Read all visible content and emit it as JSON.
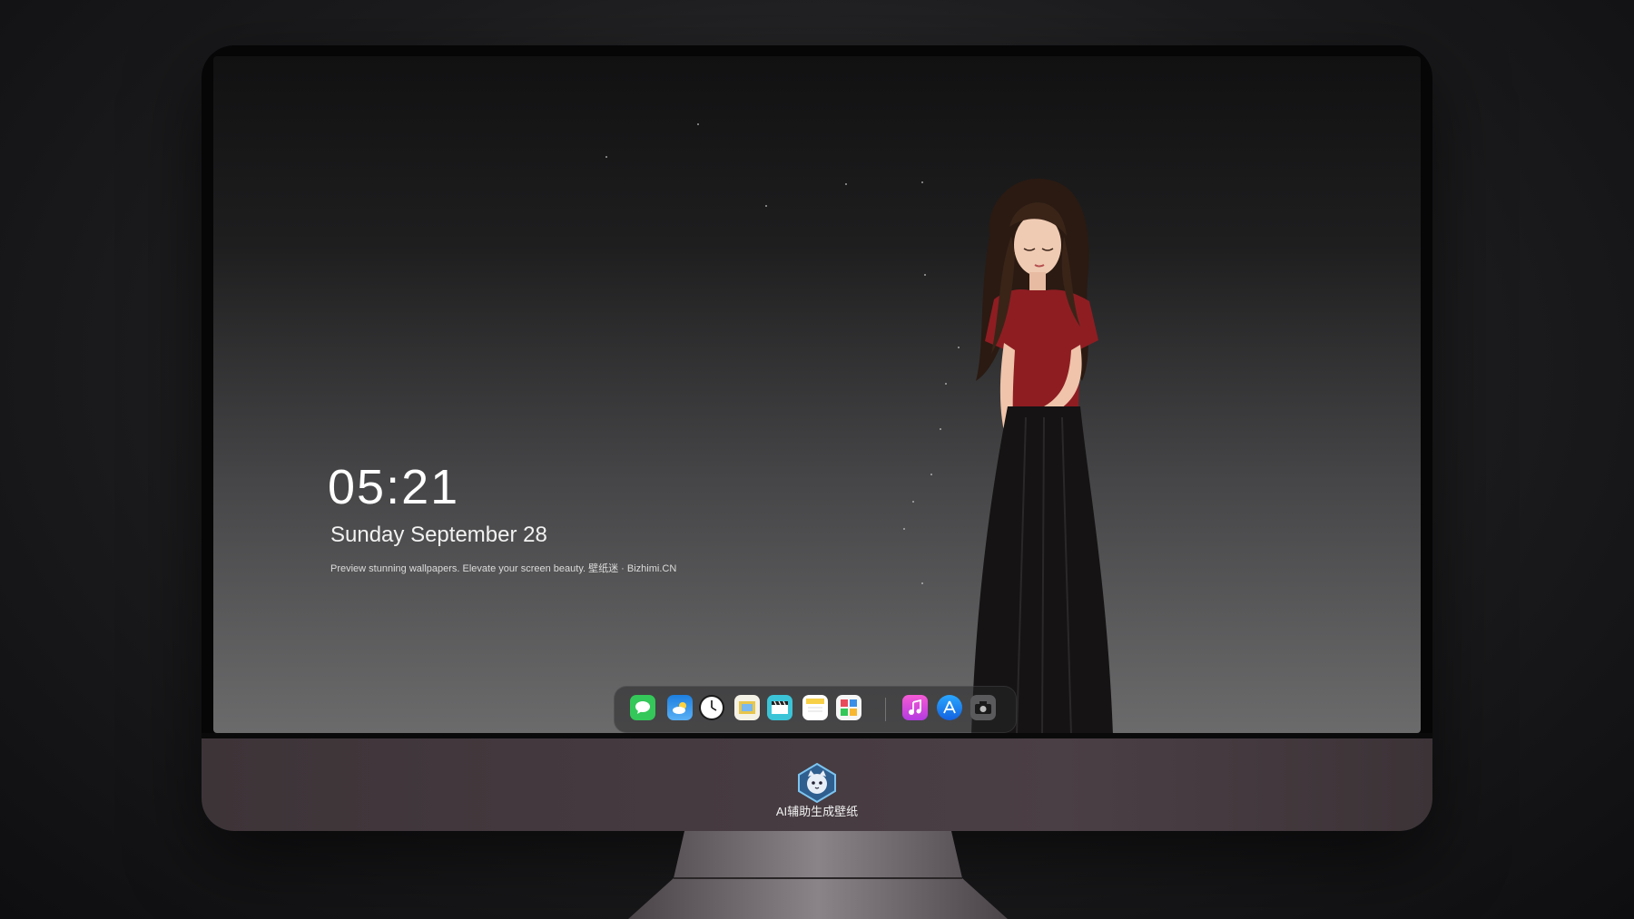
{
  "clock": {
    "time": "05:21",
    "date": "Sunday September  28",
    "caption": "Preview stunning wallpapers. Elevate your screen beauty. 壁纸迷 · Bizhimi.CN"
  },
  "dock": {
    "apps": [
      {
        "name": "Messages",
        "icon": "message-bubble-icon",
        "color": "#34c759"
      },
      {
        "name": "Weather",
        "icon": "cloud-icon",
        "color": "#3a8ee6"
      },
      {
        "name": "Clock",
        "icon": "clock-icon",
        "color": "#ffffff"
      },
      {
        "name": "Preview",
        "icon": "picture-frame-icon",
        "color": "#e8c64b"
      },
      {
        "name": "Clips",
        "icon": "clapperboard-icon",
        "color": "#3bc4d8"
      },
      {
        "name": "Notes",
        "icon": "notes-icon",
        "color": "#f7d048"
      },
      {
        "name": "Photos",
        "icon": "photo-grid-icon",
        "color": "#e94b5a"
      },
      {
        "name": "Music",
        "icon": "music-note-icon",
        "color": "#d54be0"
      },
      {
        "name": "App Store",
        "icon": "app-store-icon",
        "color": "#1e7cf5"
      },
      {
        "name": "Camera",
        "icon": "camera-icon",
        "color": "#6b6b6e"
      }
    ]
  },
  "monitor": {
    "brand_label": "AI辅助生成壁纸",
    "logo_icon": "cat-mascot-logo"
  }
}
